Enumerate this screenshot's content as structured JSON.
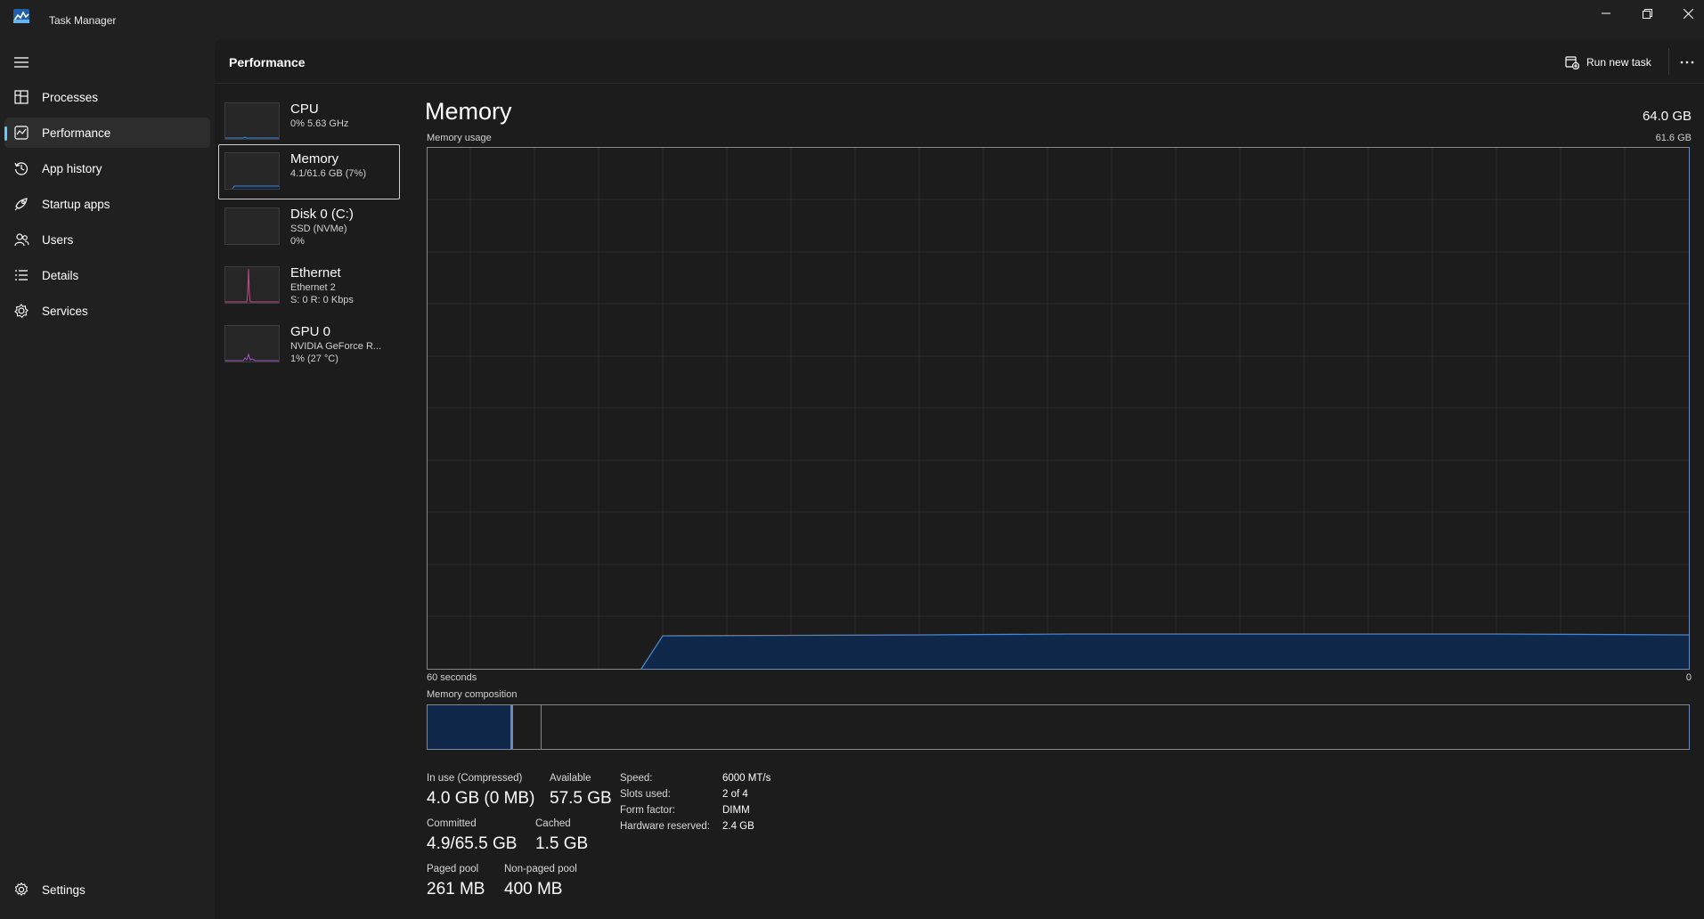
{
  "window": {
    "title": "Task Manager"
  },
  "sidebar": {
    "items": [
      {
        "label": "Processes",
        "icon": "processes-icon"
      },
      {
        "label": "Performance",
        "icon": "performance-icon",
        "active": true
      },
      {
        "label": "App history",
        "icon": "history-icon"
      },
      {
        "label": "Startup apps",
        "icon": "startup-icon"
      },
      {
        "label": "Users",
        "icon": "users-icon"
      },
      {
        "label": "Details",
        "icon": "details-icon"
      },
      {
        "label": "Services",
        "icon": "services-icon"
      }
    ],
    "settings_label": "Settings"
  },
  "header": {
    "title": "Performance",
    "run_new_task": "Run new task"
  },
  "devices": [
    {
      "name": "CPU",
      "line1": "0%  5.63 GHz",
      "line2": ""
    },
    {
      "name": "Memory",
      "line1": "4.1/61.6 GB (7%)",
      "line2": "",
      "selected": true
    },
    {
      "name": "Disk 0 (C:)",
      "line1": "SSD (NVMe)",
      "line2": "0%"
    },
    {
      "name": "Ethernet",
      "line1": "Ethernet 2",
      "line2": "S: 0  R: 0 Kbps"
    },
    {
      "name": "GPU 0",
      "line1": "NVIDIA GeForce R...",
      "line2": "1%  (27 °C)"
    }
  ],
  "detail": {
    "title": "Memory",
    "total": "64.0 GB",
    "usage_label": "Memory usage",
    "usage_max": "61.6 GB",
    "time_left": "60 seconds",
    "time_right": "0",
    "composition_label": "Memory composition",
    "stats": {
      "in_use_label": "In use (Compressed)",
      "in_use_value": "4.0 GB (0 MB)",
      "available_label": "Available",
      "available_value": "57.5 GB",
      "committed_label": "Committed",
      "committed_value": "4.9/65.5 GB",
      "cached_label": "Cached",
      "cached_value": "1.5 GB",
      "paged_label": "Paged pool",
      "paged_value": "261 MB",
      "nonpaged_label": "Non-paged pool",
      "nonpaged_value": "400 MB"
    },
    "specs": [
      {
        "key": "Speed:",
        "value": "6000 MT/s"
      },
      {
        "key": "Slots used:",
        "value": "2 of 4"
      },
      {
        "key": "Form factor:",
        "value": "DIMM"
      },
      {
        "key": "Hardware reserved:",
        "value": "2.4 GB"
      }
    ]
  },
  "colors": {
    "accent": "#60cdff",
    "memory_line": "#4a83c9",
    "memory_fill": "#0f2748",
    "chart_border": "#6f8ab8",
    "ethernet_line": "#c04e86"
  }
}
